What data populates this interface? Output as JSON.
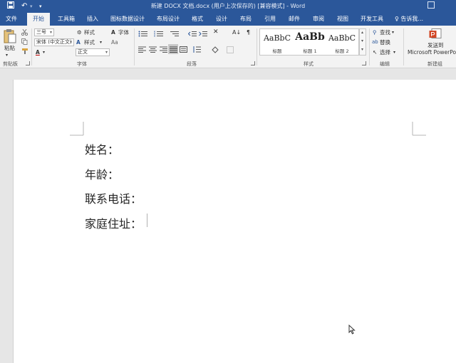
{
  "titlebar": {
    "title": "新建 DOCX 文档.docx (用户上次保存的) [兼容模式] - Word",
    "save_icon": "save-icon",
    "undo_icon": "undo-icon"
  },
  "tabs": [
    {
      "label": "文件"
    },
    {
      "label": "开始"
    },
    {
      "label": "工具箱"
    },
    {
      "label": "插入"
    },
    {
      "label": "图标数据设计"
    },
    {
      "label": "布局设计"
    },
    {
      "label": "格式"
    },
    {
      "label": "设计"
    },
    {
      "label": "布局"
    },
    {
      "label": "引用"
    },
    {
      "label": "邮件"
    },
    {
      "label": "审阅"
    },
    {
      "label": "视图"
    },
    {
      "label": "开发工具"
    }
  ],
  "tellme": "♀ 告诉我...",
  "ribbon": {
    "clipboard": {
      "paste": "粘贴",
      "label": "剪贴板"
    },
    "font": {
      "size": "三号",
      "font_name": "宋体 (中文正文)",
      "style_box": "正文",
      "style_btn": "样式",
      "style_btn2": "样式",
      "font_btn": "字体",
      "aa": "Aa",
      "label": "字体"
    },
    "paragraph": {
      "label": "段落"
    },
    "styles": {
      "items": [
        {
          "sample": "AaBbC",
          "name": "标题"
        },
        {
          "sample": "AaBb",
          "name": "标题 1"
        },
        {
          "sample": "AaBbC",
          "name": "标题 2"
        }
      ],
      "label": "样式"
    },
    "editing": {
      "find": "查找",
      "replace": "替换",
      "select": "选择",
      "label": "编辑"
    },
    "send": {
      "line1": "发送到",
      "line2": "Microsoft PowerPoint",
      "label": "新建组"
    }
  },
  "document": {
    "lines": [
      "姓名：",
      "年龄：",
      "联系电话：",
      "家庭住址："
    ]
  }
}
